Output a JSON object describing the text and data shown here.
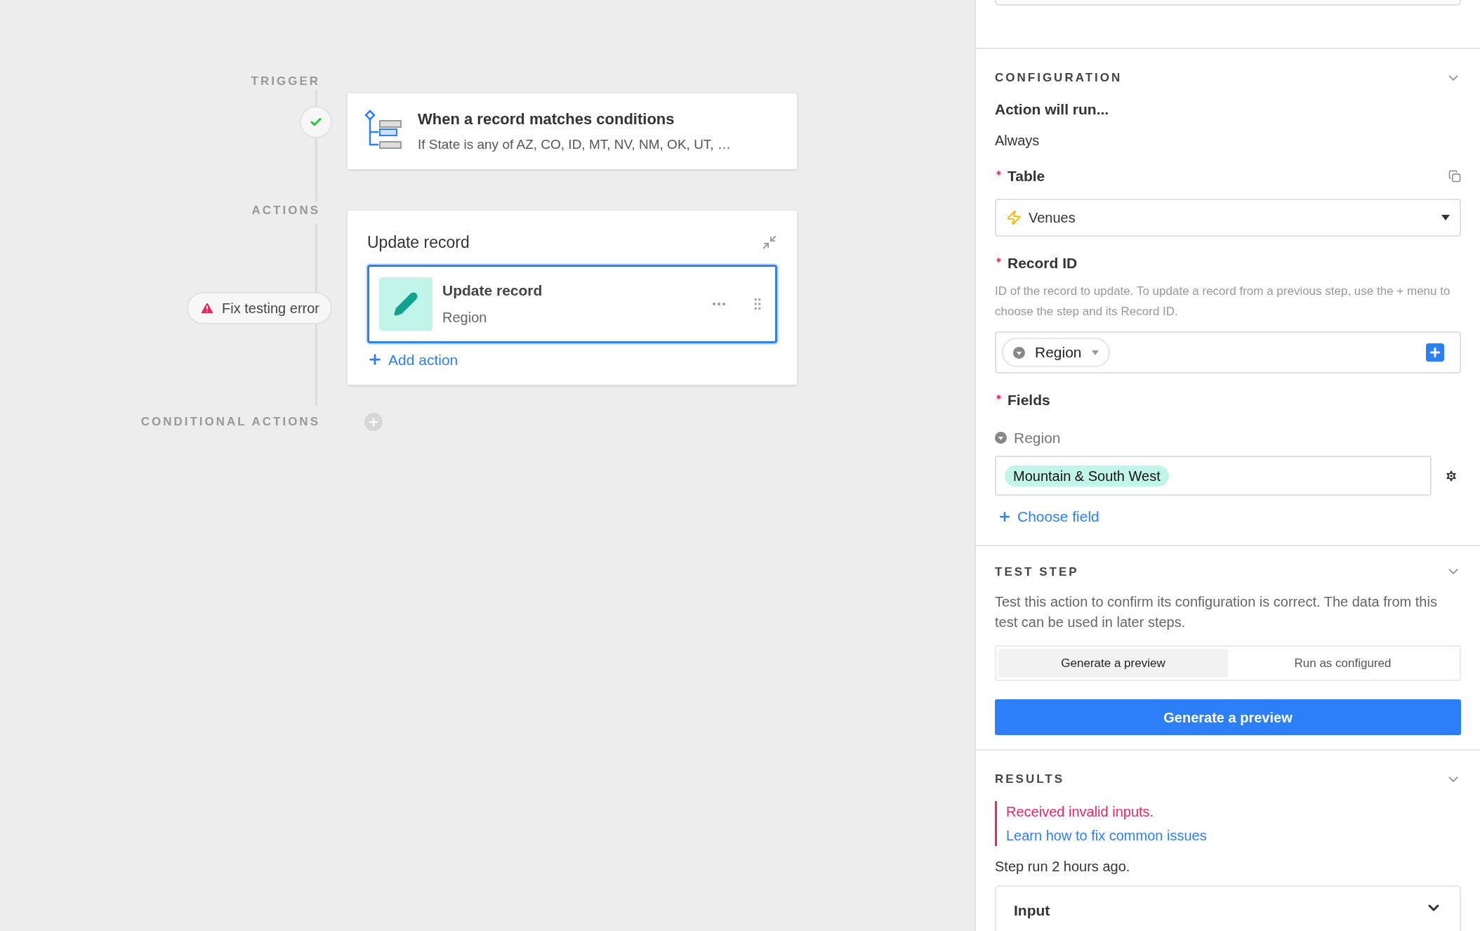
{
  "trigger": {
    "label": "TRIGGER",
    "completed": true,
    "title": "When a record matches conditions",
    "subtitle": "If State is any of AZ, CO, ID, MT, NV, NM, OK, UT, …"
  },
  "actions": {
    "label": "ACTIONS",
    "error_badge": "Fix testing error",
    "group_title": "Update record",
    "add_action": "Add action",
    "steps": [
      {
        "title": "Update record",
        "subtitle": "Region",
        "selected": true
      }
    ]
  },
  "conditional_actions": {
    "label": "CONDITIONAL ACTIONS"
  },
  "configuration": {
    "title": "CONFIGURATION",
    "run_label": "Action will run...",
    "run_value": "Always",
    "table": {
      "label": "Table",
      "required": true,
      "value": "Venues"
    },
    "record_id": {
      "label": "Record ID",
      "required": true,
      "description": "ID of the record to update. To update a record from a previous step, use the + menu to choose the step and its Record ID.",
      "token": "Region"
    },
    "fields": {
      "label": "Fields",
      "required": true,
      "add": "Choose field",
      "items": [
        {
          "name": "Region",
          "values": [
            "Mountain & South West"
          ]
        }
      ]
    }
  },
  "test_step": {
    "title": "TEST STEP",
    "description": "Test this action to confirm its configuration is correct. The data from this test can be used in later steps.",
    "modes": [
      {
        "label": "Generate a preview",
        "selected": true
      },
      {
        "label": "Run as configured",
        "selected": false
      }
    ],
    "button": "Generate a preview"
  },
  "results": {
    "title": "RESULTS",
    "error": "Received invalid inputs.",
    "link": "Learn how to fix common issues",
    "run_info": "Step run 2 hours ago.",
    "input_label": "Input"
  }
}
